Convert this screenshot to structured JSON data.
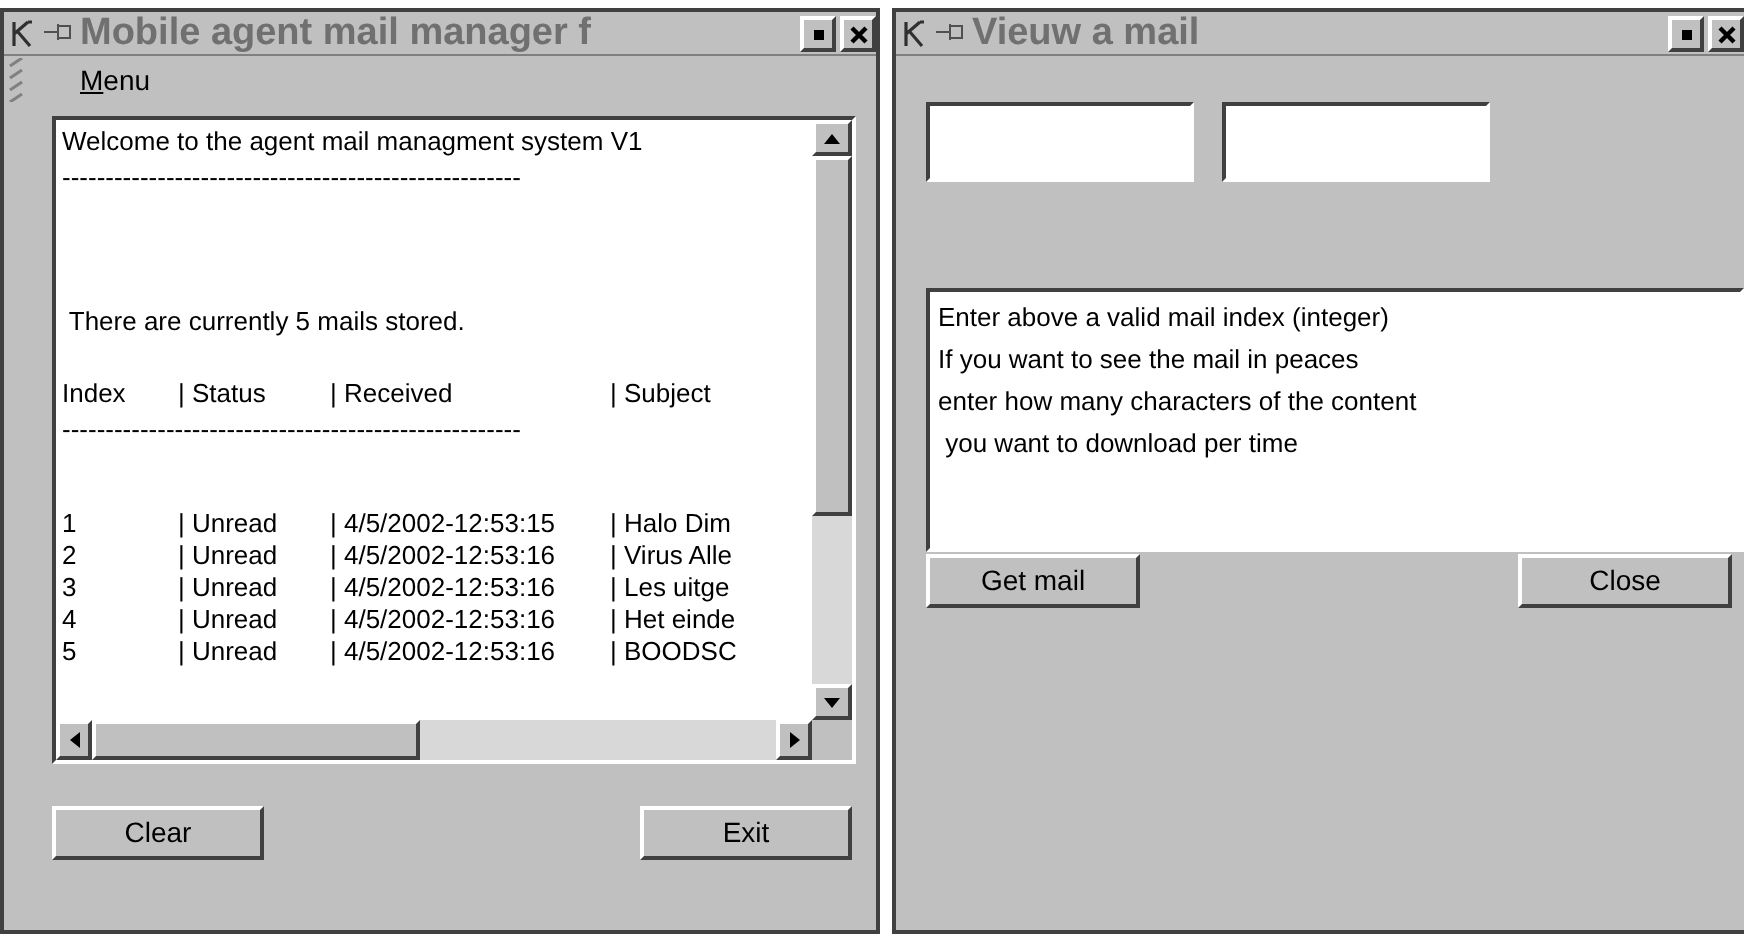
{
  "main_window": {
    "title": "Mobile agent mail manager f",
    "menu": {
      "label": "Menu"
    },
    "log": {
      "welcome": "Welcome to the agent mail managment system V1",
      "separator_1": "-----------------------------------------------------",
      "summary": "There are currently 5 mails stored.",
      "columns": [
        "Index",
        "| Status",
        "| Received",
        "| Subject"
      ],
      "separator_2": "-----------------------------------------------------",
      "rows": [
        {
          "index": "1",
          "status": "| Unread",
          "received": "| 4/5/2002-12:53:15",
          "subject": "| Halo Dim"
        },
        {
          "index": "2",
          "status": "| Unread",
          "received": "| 4/5/2002-12:53:16",
          "subject": "| Virus Alle"
        },
        {
          "index": "3",
          "status": "| Unread",
          "received": "| 4/5/2002-12:53:16",
          "subject": "| Les uitge"
        },
        {
          "index": "4",
          "status": "| Unread",
          "received": "| 4/5/2002-12:53:16",
          "subject": "| Het einde"
        },
        {
          "index": "5",
          "status": "| Unread",
          "received": "| 4/5/2002-12:53:16",
          "subject": "| BOODSC"
        }
      ]
    },
    "buttons": [
      "Clear",
      "Exit"
    ]
  },
  "view_window": {
    "title": "Vieuw a mail",
    "instructions": [
      "Enter above a valid mail index (integer)",
      "If you want to see the mail in peaces",
      "enter how many characters of the content",
      " you want to download per time"
    ],
    "buttons": [
      "Get mail",
      "Close"
    ]
  }
}
